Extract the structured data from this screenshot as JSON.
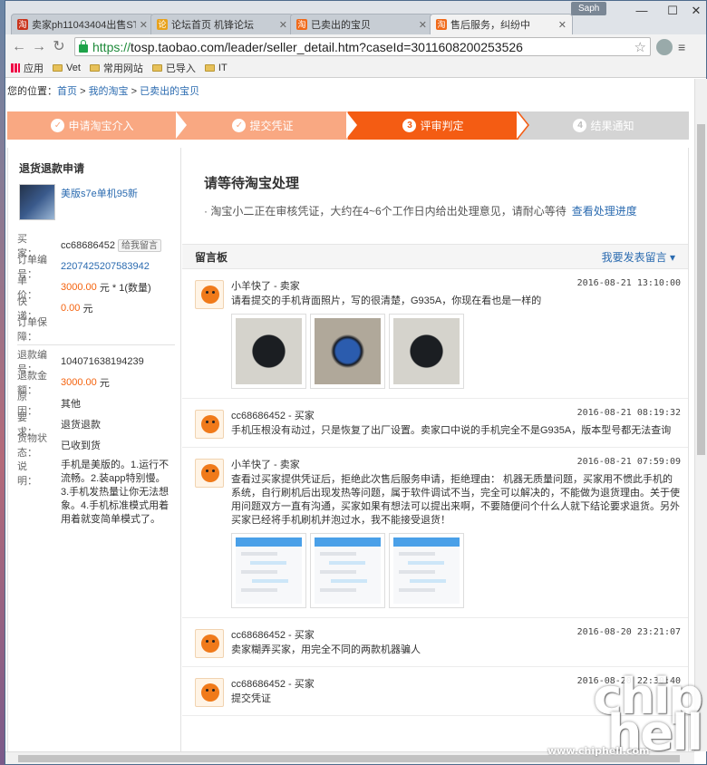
{
  "browser": {
    "tabs": [
      {
        "label": "卖家ph11043404出售ST",
        "favicon": "taobao-icon",
        "active": false
      },
      {
        "label": "论坛首页 机锋论坛",
        "favicon": "forum-icon",
        "active": false
      },
      {
        "label": "已卖出的宝贝",
        "favicon": "taobao-icon",
        "active": false
      },
      {
        "label": "售后服务，纠纷中",
        "favicon": "taobao-icon",
        "active": true
      }
    ],
    "profile": "Saph",
    "url_scheme": "https://",
    "url_rest": "tosp.taobao.com/leader/seller_detail.htm?caseId=3011608200253526",
    "bookmarks": [
      "应用",
      "Vet",
      "常用网站",
      "已导入",
      "IT"
    ]
  },
  "breadcrumb": {
    "prefix": "您的位置：",
    "items": [
      "首页",
      "我的淘宝",
      "已卖出的宝贝"
    ],
    "sep": ">"
  },
  "steps": [
    {
      "num": "✓",
      "label": "申请淘宝介入",
      "state": "done"
    },
    {
      "num": "✓",
      "label": "提交凭证",
      "state": "done"
    },
    {
      "num": "3",
      "label": "评审判定",
      "state": "current"
    },
    {
      "num": "4",
      "label": "结果通知",
      "state": "todo"
    }
  ],
  "sidebar": {
    "title": "退货退款申请",
    "product_name": "美版s7e单机95新",
    "buyer_label": "买　　家：",
    "buyer": "cc68686452",
    "msg_button": "给我留言",
    "order_label": "订单编号：",
    "order_no": "2207425207583942",
    "price_label": "单　　价：",
    "price": "3000.00",
    "price_suffix": "元 * 1(数量)",
    "ship_label": "快　　递：",
    "ship": "0.00",
    "ship_suffix": "元",
    "guarantee_label": "订单保障：",
    "refund_no_label": "退款编号：",
    "refund_no": "104071638194239",
    "refund_amt_label": "退款金额：",
    "refund_amt": "3000.00",
    "refund_amt_suffix": "元",
    "reason_label": "原　　因：",
    "reason": "其他",
    "request_label": "要　　求：",
    "request": "退货退款",
    "goods_label": "货物状态：",
    "goods": "已收到货",
    "desc_label": "说　　明：",
    "desc": "手机是美版的。1.运行不流畅。2.装app特别慢。3.手机发热量让你无法想象。4.手机标准模式用着用着就变简单模式了。"
  },
  "main": {
    "pending_title": "请等待淘宝处理",
    "pending_text": "· 淘宝小二正在审核凭证，大约在4~6个工作日内给出处理意见，请耐心等待",
    "pending_link": "查看处理进度",
    "board_title": "留言板",
    "board_post": "我要发表留言 ▾",
    "messages": [
      {
        "author": "小羊快了 - 卖家",
        "time": "2016-08-21 13:10:00",
        "text": "请看提交的手机背面照片，写的很清楚，G935A，你现在看也是一样的",
        "pics": [
          "phone-back",
          "phone-front",
          "phone-back"
        ]
      },
      {
        "author": "cc68686452 - 买家",
        "time": "2016-08-21 08:19:32",
        "text": "手机压根没有动过，只是恢复了出厂设置。卖家口中说的手机完全不是G935A，版本型号都无法查询",
        "pics": []
      },
      {
        "author": "小羊快了 - 卖家",
        "time": "2016-08-21 07:59:09",
        "text": "查看过买家提供凭证后，拒绝此次售后服务申请，拒绝理由： 机器无质量问题，买家用不惯此手机的系统，自行刷机后出现发热等问题，属于软件调试不当，完全可以解决的，不能做为退货理由。关于使用问题双方一直有沟通，买家如果有想法可以提出来啊，不要随便问个什么人就下结论要求退货。另外买家已经将手机刷机并泡过水，我不能接受退货！",
        "pics": [
          "chat",
          "chat",
          "chat"
        ]
      },
      {
        "author": "cc68686452 - 买家",
        "time": "2016-08-20 23:21:07",
        "text": "卖家糊弄买家，用完全不同的两款机器骗人",
        "pics": []
      },
      {
        "author": "cc68686452 - 买家",
        "time": "2016-08-20 22:30:40",
        "text": "提交凭证",
        "pics": []
      }
    ]
  },
  "watermark": {
    "text": "chip hell",
    "url": "www.chiphell.com"
  },
  "colors": {
    "accent": "#f45c13",
    "link": "#2b6bb0",
    "step_done": "#f9a882",
    "step_todo": "#d4d4d4"
  }
}
